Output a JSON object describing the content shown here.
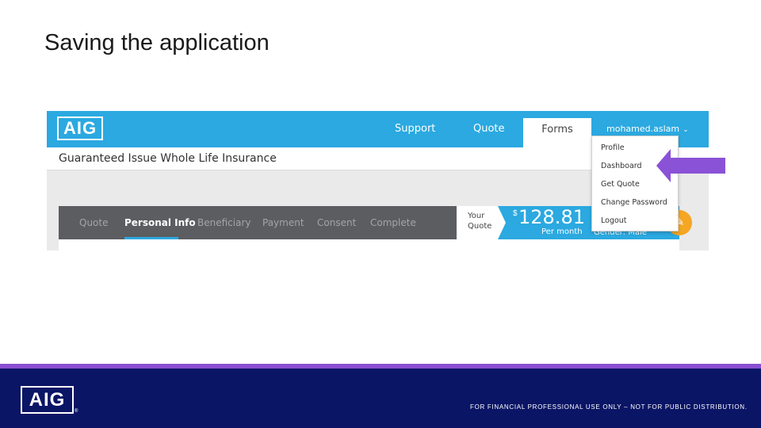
{
  "slide": {
    "title": "Saving the application"
  },
  "app": {
    "logo_text": "AIG",
    "nav": {
      "support": "Support",
      "quote": "Quote",
      "forms": "Forms",
      "user": "mohamed.aslam"
    },
    "product_title": "Guaranteed Issue Whole Life Insurance",
    "steps": [
      "Quote",
      "Personal Info",
      "Beneficiary",
      "Payment",
      "Consent",
      "Complete"
    ],
    "active_step": "Personal Info",
    "quote_label_line1": "Your",
    "quote_label_line2": "Quote",
    "price_currency": "$",
    "price_amount": "128.81",
    "price_period": "Per month",
    "gender_text": "Gender: Male",
    "user_menu": [
      "Profile",
      "Dashboard",
      "Get Quote",
      "Change Password",
      "Logout"
    ],
    "highlighted_menu_item": "Dashboard"
  },
  "footer": {
    "logo_text": "AIG",
    "registered_mark": "®",
    "disclaimer": "FOR FINANCIAL PROFESSIONAL USE ONLY – NOT FOR PUBLIC DISTRIBUTION."
  },
  "colors": {
    "brand_blue": "#2ba9e0",
    "navy": "#0a1565",
    "purple_accent": "#8a4fd0",
    "arrow_purple": "#8a52d6",
    "edit_orange": "#f5a623"
  },
  "icons": {
    "chevron": "chevron-down-icon",
    "edit": "pencil-icon",
    "pointer": "arrow-left-icon"
  }
}
